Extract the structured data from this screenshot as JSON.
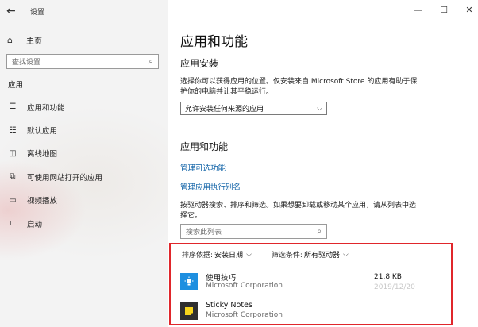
{
  "window": {
    "app_title": "设置",
    "controls": {
      "minimize": "—",
      "maximize": "☐",
      "close": "✕"
    }
  },
  "sidebar": {
    "back_glyph": "←",
    "home": {
      "icon": "home-icon",
      "label": "主页"
    },
    "search": {
      "placeholder": "查找设置"
    },
    "section": "应用",
    "items": [
      {
        "icon": "apps-features-icon",
        "label": "应用和功能"
      },
      {
        "icon": "default-apps-icon",
        "label": "默认应用"
      },
      {
        "icon": "offline-maps-icon",
        "label": "离线地图"
      },
      {
        "icon": "apps-for-websites-icon",
        "label": "可使用网站打开的应用"
      },
      {
        "icon": "video-playback-icon",
        "label": "视频播放"
      },
      {
        "icon": "startup-icon",
        "label": "启动"
      }
    ]
  },
  "main": {
    "title": "应用和功能",
    "install": {
      "heading": "应用安装",
      "description": "选择你可以获得应用的位置。仅安装来自 Microsoft Store 的应用有助于保护你的电脑并让其平稳运行。",
      "dropdown_value": "允许安装任何来源的应用"
    },
    "apps": {
      "heading": "应用和功能",
      "links": [
        "管理可选功能",
        "管理应用执行别名"
      ],
      "description": "按驱动器搜索、排序和筛选。如果想要卸载或移动某个应用，请从列表中选择它。",
      "search_placeholder": "搜索此列表",
      "sort_label": "排序依据:",
      "sort_value": "安装日期",
      "filter_label": "筛选条件:",
      "filter_value": "所有驱动器",
      "list": [
        {
          "name": "使用技巧",
          "publisher": "Microsoft Corporation",
          "size": "21.8 KB",
          "date": "2019/12/20",
          "icon": "tips-icon"
        },
        {
          "name": "Sticky Notes",
          "publisher": "Microsoft Corporation",
          "size": "",
          "date": "",
          "icon": "sticky-notes-icon"
        }
      ]
    }
  },
  "colors": {
    "link": "#0b5fa5",
    "highlight_border": "#e0262b",
    "tips_icon_bg": "#1e8fe0"
  }
}
